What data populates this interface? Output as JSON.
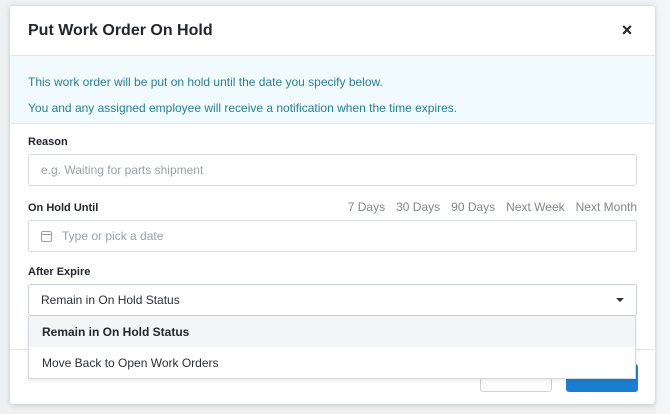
{
  "modal": {
    "title": "Put Work Order On Hold",
    "close_label": "×"
  },
  "info": {
    "line1": "This work order will be put on hold until the date you specify below.",
    "line2": "You and any assigned employee will receive a notification when the time expires."
  },
  "reason": {
    "label": "Reason",
    "placeholder": "e.g. Waiting for parts shipment"
  },
  "on_hold_until": {
    "label": "On Hold Until",
    "placeholder": "Type or pick a date",
    "quick_options": [
      "7 Days",
      "30 Days",
      "90 Days",
      "Next Week",
      "Next Month"
    ]
  },
  "after_expire": {
    "label": "After Expire",
    "selected": "Remain in On Hold Status",
    "options": [
      "Remain in On Hold Status",
      "Move Back to Open Work Orders"
    ]
  },
  "icons": {
    "close": "close-icon",
    "calendar": "calendar-icon",
    "dropdown": "chevron-down-icon"
  },
  "colors": {
    "info_text": "#2a7e96",
    "info_bg": "#f1fbfd",
    "primary": "#1b7fd1"
  }
}
